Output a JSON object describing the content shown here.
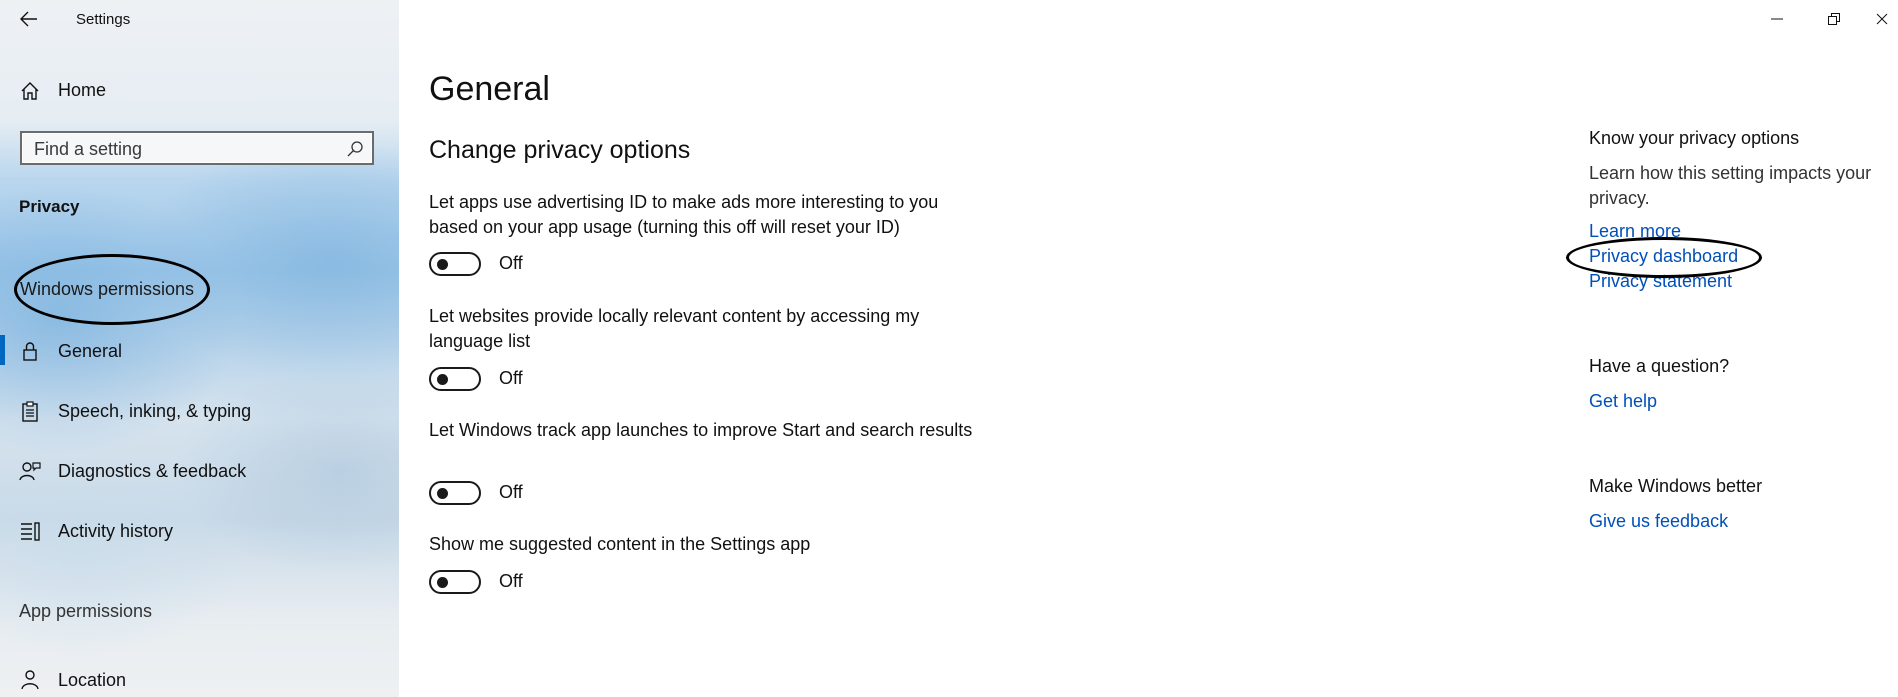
{
  "window": {
    "title": "Settings",
    "controls": [
      "minimize-icon",
      "restore-icon",
      "close-icon"
    ]
  },
  "sidebar": {
    "home_label": "Home",
    "search": {
      "placeholder": "Find a setting",
      "value": ""
    },
    "section_privacy": "Privacy",
    "section_windows_permissions": "Windows permissions",
    "items": [
      {
        "label": "General",
        "icon": "lock-icon",
        "active": true
      },
      {
        "label": "Speech, inking, & typing",
        "icon": "clipboard-icon",
        "active": false
      },
      {
        "label": "Diagnostics & feedback",
        "icon": "person-feedback-icon",
        "active": false
      },
      {
        "label": "Activity history",
        "icon": "activity-icon",
        "active": false
      }
    ],
    "section_app_permissions": "App permissions",
    "app_items": [
      {
        "label": "Location",
        "icon": "location-person-icon"
      }
    ]
  },
  "main": {
    "title": "General",
    "subtitle": "Change privacy options",
    "settings": [
      {
        "description": "Let apps use advertising ID to make ads more interesting to you based on your app usage (turning this off will reset your ID)",
        "state": "Off"
      },
      {
        "description": "Let websites provide locally relevant content by accessing my language list",
        "state": "Off"
      },
      {
        "description": "Let Windows track app launches to improve Start and search results",
        "state": "Off"
      },
      {
        "description": "Show me suggested content in the Settings app",
        "state": "Off"
      }
    ]
  },
  "right": {
    "know_heading": "Know your privacy options",
    "know_text": "Learn how this setting impacts your privacy.",
    "links": [
      "Learn more",
      "Privacy dashboard",
      "Privacy statement"
    ],
    "question_heading": "Have a question?",
    "get_help": "Get help",
    "better_heading": "Make Windows better",
    "feedback": "Give us feedback"
  },
  "colors": {
    "accent": "#0067c0",
    "link": "#0050b8",
    "annotation": "#000000"
  }
}
